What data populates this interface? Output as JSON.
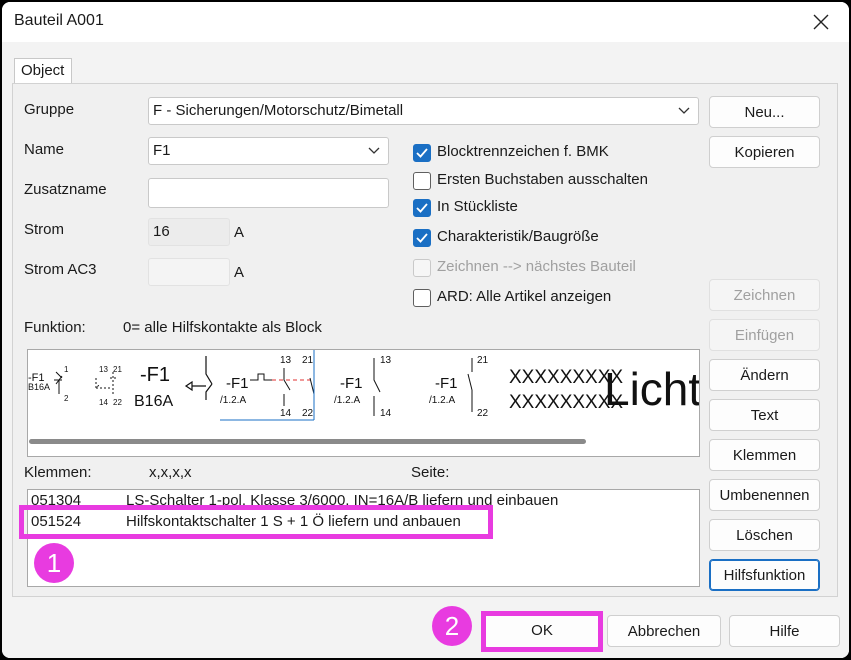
{
  "window": {
    "title": "Bauteil A001"
  },
  "tabs": [
    {
      "label": "Object"
    }
  ],
  "fields": {
    "gruppe": {
      "label": "Gruppe",
      "value": "F - Sicherungen/Motorschutz/Bimetall"
    },
    "name": {
      "label": "Name",
      "value": "F1"
    },
    "zusatzname": {
      "label": "Zusatzname",
      "value": ""
    },
    "strom": {
      "label": "Strom",
      "value": "16",
      "unit": "A"
    },
    "strom_ac3": {
      "label": "Strom AC3",
      "value": "",
      "unit": "A"
    }
  },
  "checkboxes": [
    {
      "label": "Blocktrennzeichen f. BMK",
      "checked": true,
      "disabled": false
    },
    {
      "label": "Ersten Buchstaben ausschalten",
      "checked": false,
      "disabled": false
    },
    {
      "label": "In Stückliste",
      "checked": true,
      "disabled": false
    },
    {
      "label": "Charakteristik/Baugröße",
      "checked": true,
      "disabled": false
    },
    {
      "label": "Zeichnen --> nächstes Bauteil",
      "checked": false,
      "disabled": true
    },
    {
      "label": "ARD: Alle Artikel anzeigen",
      "checked": false,
      "disabled": false
    }
  ],
  "side_buttons": [
    {
      "label": "Neu...",
      "disabled": false
    },
    {
      "label": "Kopieren",
      "disabled": false
    },
    {
      "label": "Zeichnen",
      "disabled": true
    },
    {
      "label": "Einfügen",
      "disabled": true
    },
    {
      "label": "Ändern",
      "disabled": false
    },
    {
      "label": "Text",
      "disabled": false
    },
    {
      "label": "Klemmen",
      "disabled": false
    },
    {
      "label": "Umbenennen",
      "disabled": false
    },
    {
      "label": "Löschen",
      "disabled": false
    },
    {
      "label": "Hilfsfunktion",
      "disabled": false
    }
  ],
  "funktion": {
    "label": "Funktion:",
    "value": "0= alle Hilfskontakte als Block"
  },
  "preview": {
    "symbols": [
      {
        "bmk": "-F1",
        "sub": "B16A",
        "pins": [
          "1",
          "2"
        ]
      },
      {
        "pins": [
          "13",
          "21",
          "14",
          "22"
        ]
      },
      {
        "bmk": "-F1",
        "sub": "B16A"
      },
      {
        "bmk": "-F1",
        "ref": "/1.2.A",
        "pins": [
          "13",
          "21",
          "14",
          "22"
        ]
      },
      {
        "bmk": "-F1",
        "ref": "/1.2.A",
        "pins": [
          "13",
          "14"
        ]
      },
      {
        "bmk": "-F1",
        "ref": "/1.2.A",
        "pins": [
          "21",
          "22"
        ]
      }
    ],
    "placeholder_lines": [
      "XXXXXXXXX",
      "XXXXXXXXX"
    ],
    "big_text": "Licht"
  },
  "klemmen": {
    "label": "Klemmen:",
    "value": "x,x,x,x",
    "seite_label": "Seite:"
  },
  "articles": [
    {
      "code": "051304",
      "description": "LS-Schalter 1-pol. Klasse 3/6000, IN=16A/B liefern und einbauen"
    },
    {
      "code": "051524",
      "description": "Hilfskontaktschalter 1 S + 1 Ö liefern und anbauen"
    }
  ],
  "annotations": [
    {
      "number": "1"
    },
    {
      "number": "2"
    }
  ],
  "footer_buttons": {
    "ok": "OK",
    "cancel": "Abbrechen",
    "help": "Hilfe"
  },
  "colors": {
    "accent": "#1a6fc4",
    "highlight": "#e83be0",
    "red_dash": "#e03030"
  }
}
